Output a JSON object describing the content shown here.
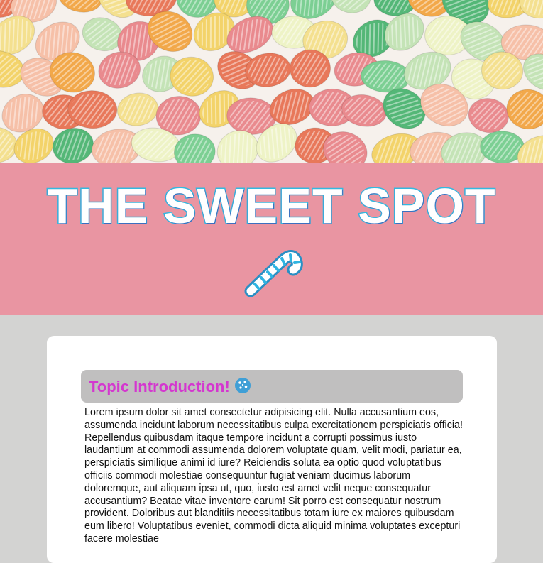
{
  "hero": {
    "image": "hard-candies-photo",
    "candy_colors": [
      "#e98a8e",
      "#f2a84a",
      "#7ccf93",
      "#f3d36a",
      "#eef3c6",
      "#e8785a",
      "#c4e3b6",
      "#f6c0a8",
      "#54b777",
      "#f4e08f"
    ]
  },
  "banner": {
    "title": "THE SWEET SPOT",
    "icon": "candy-cane-icon",
    "background_color": "#e995a2",
    "title_outline_color": "#33b9e0"
  },
  "section": {
    "heading": "Topic Introduction!",
    "heading_icon": "cookie-icon",
    "heading_color": "#d437cf",
    "body": "Lorem ipsum dolor sit amet consectetur adipisicing elit. Nulla accusantium eos, assumenda incidunt laborum necessitatibus culpa exercitationem perspiciatis officia! Repellendus quibusdam itaque tempore incidunt a corrupti possimus iusto laudantium at commodi assumenda dolorem voluptate quam, velit modi, pariatur ea, perspiciatis similique animi id iure? Reiciendis soluta ea optio quod voluptatibus officiis commodi molestiae consequuntur fugiat veniam ducimus laborum doloremque, aut aliquam ipsa ut, quo, iusto est amet velit neque consequatur accusantium? Beatae vitae inventore earum! Sit porro est consequatur nostrum provident. Doloribus aut blanditiis necessitatibus totam iure ex maiores quibusdam eum libero! Voluptatibus eveniet, commodi dicta aliquid minima voluptates excepturi facere molestiae"
  }
}
